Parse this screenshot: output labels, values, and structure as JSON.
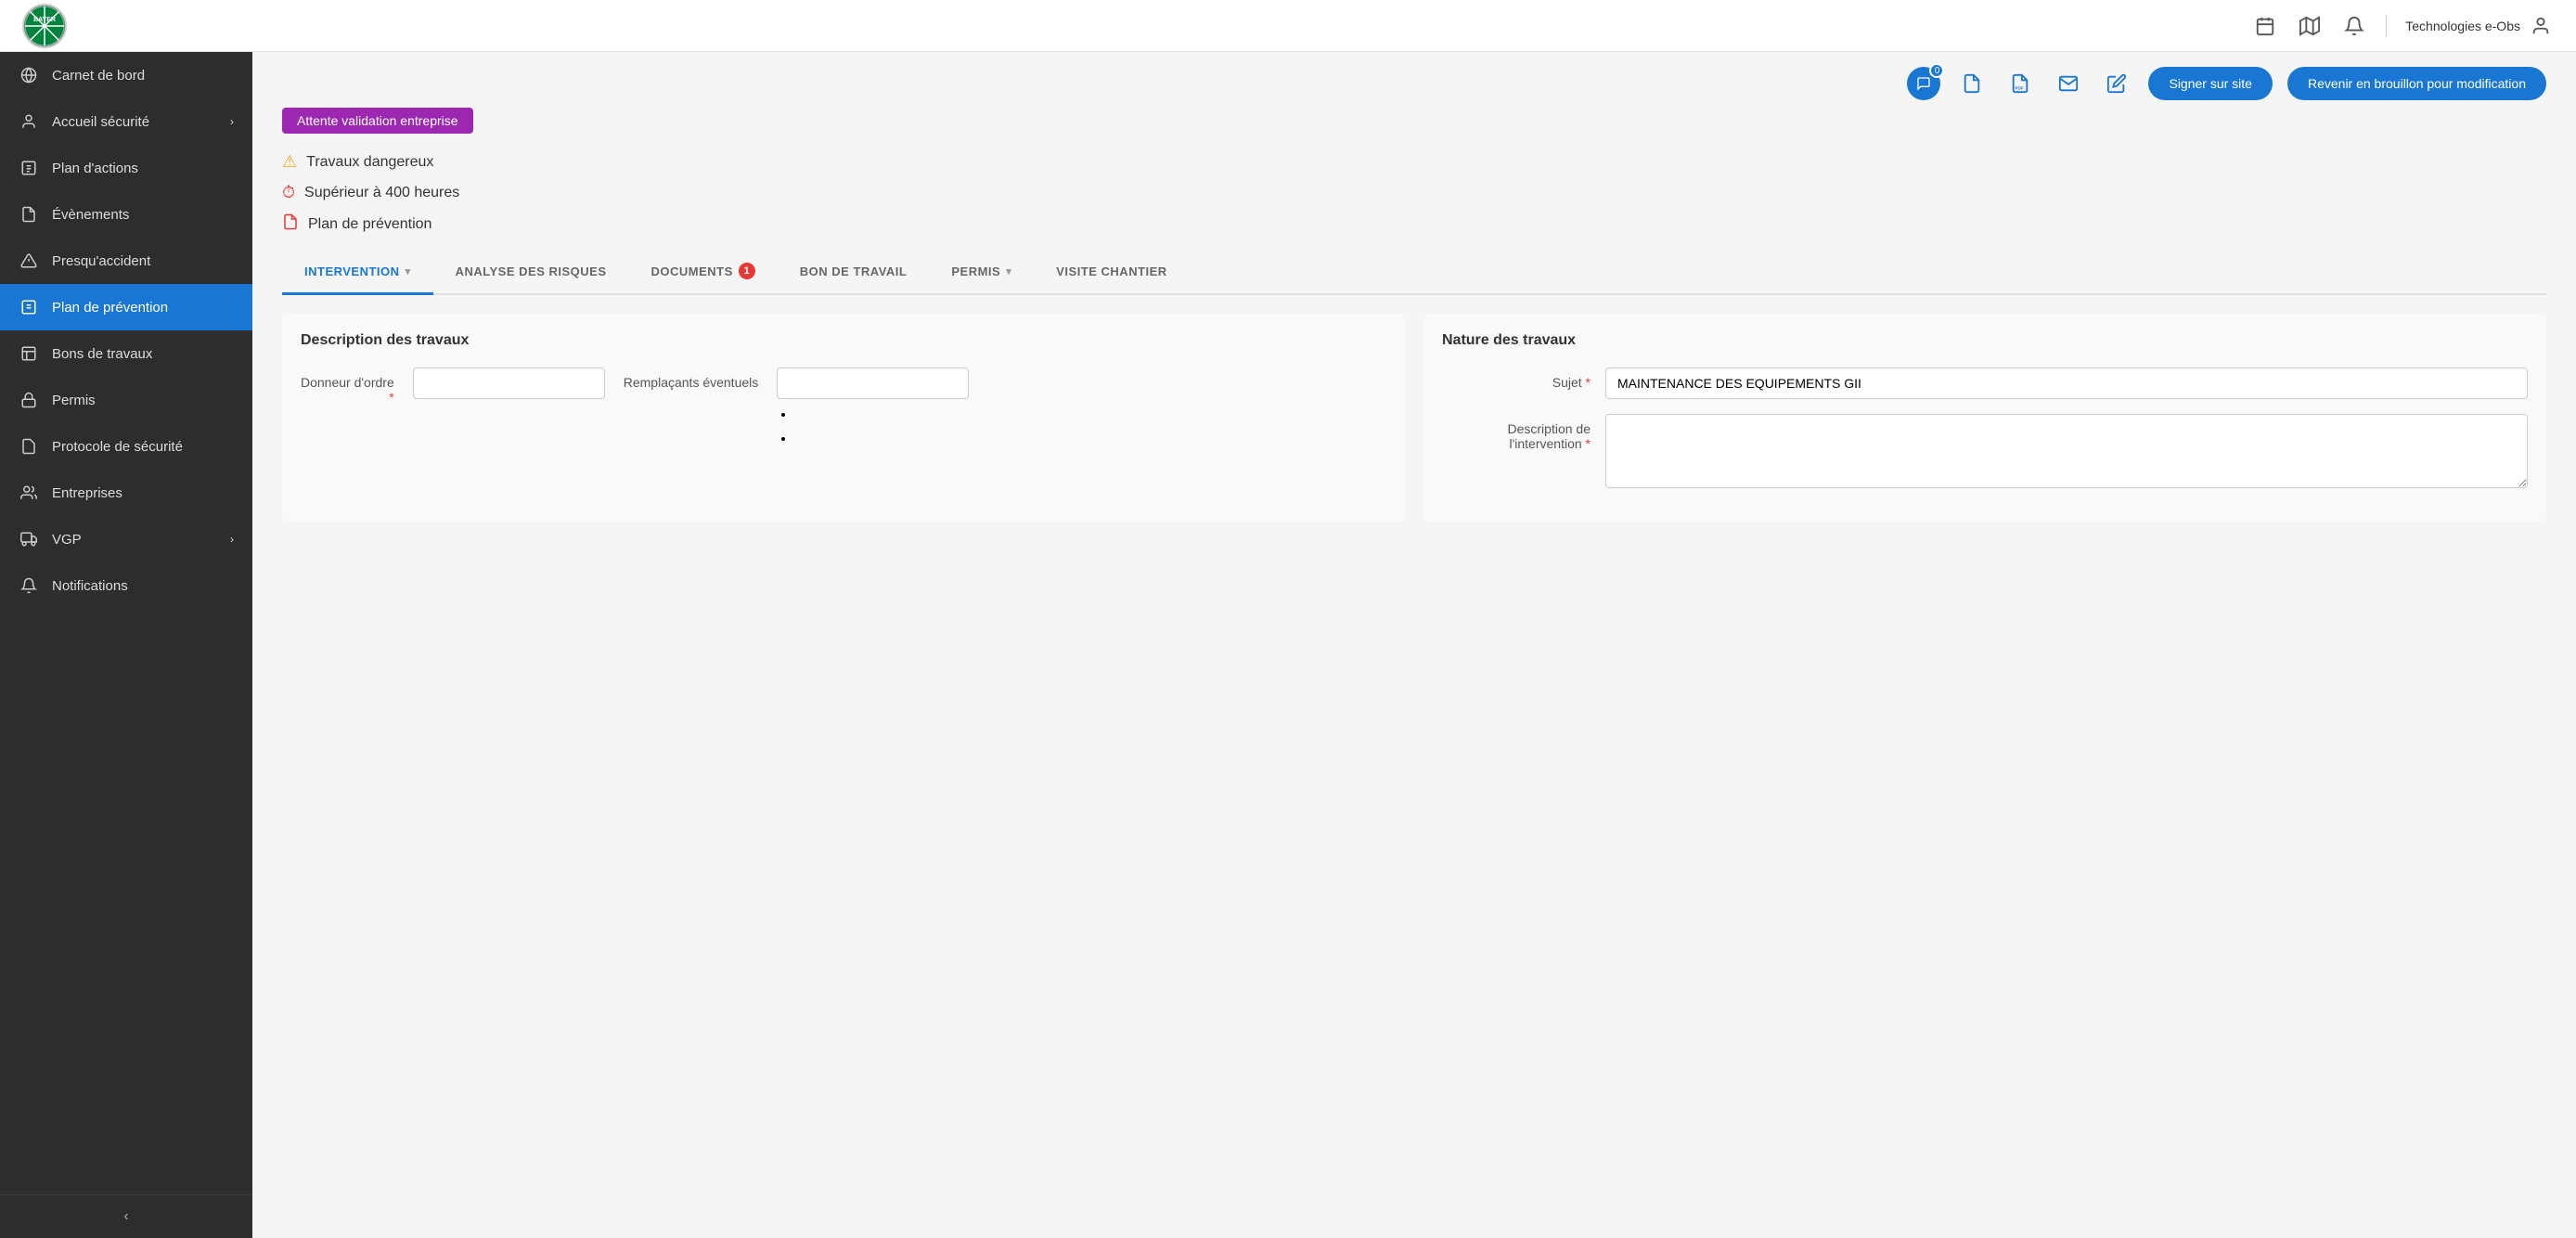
{
  "topbar": {
    "logo_text": "BAYER",
    "user_label": "Technologies e-Obs",
    "icons": {
      "calendar": "📅",
      "map": "🗺",
      "bell": "🔔"
    }
  },
  "sidebar": {
    "items": [
      {
        "id": "carnet",
        "label": "Carnet de bord",
        "icon": "🌐",
        "has_chevron": false
      },
      {
        "id": "accueil",
        "label": "Accueil sécurité",
        "icon": "👤",
        "has_chevron": true
      },
      {
        "id": "plan-actions",
        "label": "Plan d'actions",
        "icon": "📋",
        "has_chevron": false
      },
      {
        "id": "evenements",
        "label": "Évènements",
        "icon": "📄",
        "has_chevron": false
      },
      {
        "id": "presquaccident",
        "label": "Presqu'accident",
        "icon": "⚠",
        "has_chevron": false
      },
      {
        "id": "plan-prevention",
        "label": "Plan de prévention",
        "icon": "📋",
        "has_chevron": false,
        "active": true
      },
      {
        "id": "bons-travaux",
        "label": "Bons de travaux",
        "icon": "📊",
        "has_chevron": false
      },
      {
        "id": "permis",
        "label": "Permis",
        "icon": "🔑",
        "has_chevron": false
      },
      {
        "id": "protocole",
        "label": "Protocole de sécurité",
        "icon": "📋",
        "has_chevron": false
      },
      {
        "id": "entreprises",
        "label": "Entreprises",
        "icon": "👥",
        "has_chevron": false
      },
      {
        "id": "vgp",
        "label": "VGP",
        "icon": "🚗",
        "has_chevron": true
      },
      {
        "id": "notifications",
        "label": "Notifications",
        "icon": "🔔",
        "has_chevron": false
      }
    ],
    "collapse_icon": "‹"
  },
  "action_bar": {
    "chat_badge": "0",
    "btn_signer": "Signer sur site",
    "btn_brouillon": "Revenir en brouillon pour modification"
  },
  "status": {
    "badge_label": "Attente validation entreprise"
  },
  "alerts": [
    {
      "id": "travaux-dangereux",
      "icon": "warn",
      "text": "Travaux dangereux"
    },
    {
      "id": "superieur-400",
      "icon": "clock",
      "text": "Supérieur à 400 heures"
    },
    {
      "id": "plan-prevention",
      "icon": "pdf",
      "text": "Plan de prévention"
    }
  ],
  "tabs": [
    {
      "id": "intervention",
      "label": "INTERVENTION",
      "active": true,
      "has_chevron": true,
      "badge": null
    },
    {
      "id": "analyse-risques",
      "label": "ANALYSE DES RISQUES",
      "active": false,
      "has_chevron": false,
      "badge": null
    },
    {
      "id": "documents",
      "label": "DOCUMENTS",
      "active": false,
      "has_chevron": false,
      "badge": "1"
    },
    {
      "id": "bon-travail",
      "label": "BON DE TRAVAIL",
      "active": false,
      "has_chevron": false,
      "badge": null
    },
    {
      "id": "permis",
      "label": "PERMIS",
      "active": false,
      "has_chevron": true,
      "badge": null
    },
    {
      "id": "visite-chantier",
      "label": "VISITE CHANTIER",
      "active": false,
      "has_chevron": false,
      "badge": null
    }
  ],
  "description_travaux": {
    "section_title": "Description des travaux",
    "donneur_label": "Donneur d'ordre",
    "donneur_required": "*",
    "donneur_value": "",
    "remplacants_label": "Remplaçants éventuels",
    "remplacants_value": ""
  },
  "nature_travaux": {
    "section_title": "Nature des travaux",
    "sujet_label": "Sujet",
    "sujet_required": "*",
    "sujet_value": "MAINTENANCE DES EQUIPEMENTS GII",
    "description_label": "Description de l'intervention",
    "description_required": "*",
    "description_value": ""
  }
}
